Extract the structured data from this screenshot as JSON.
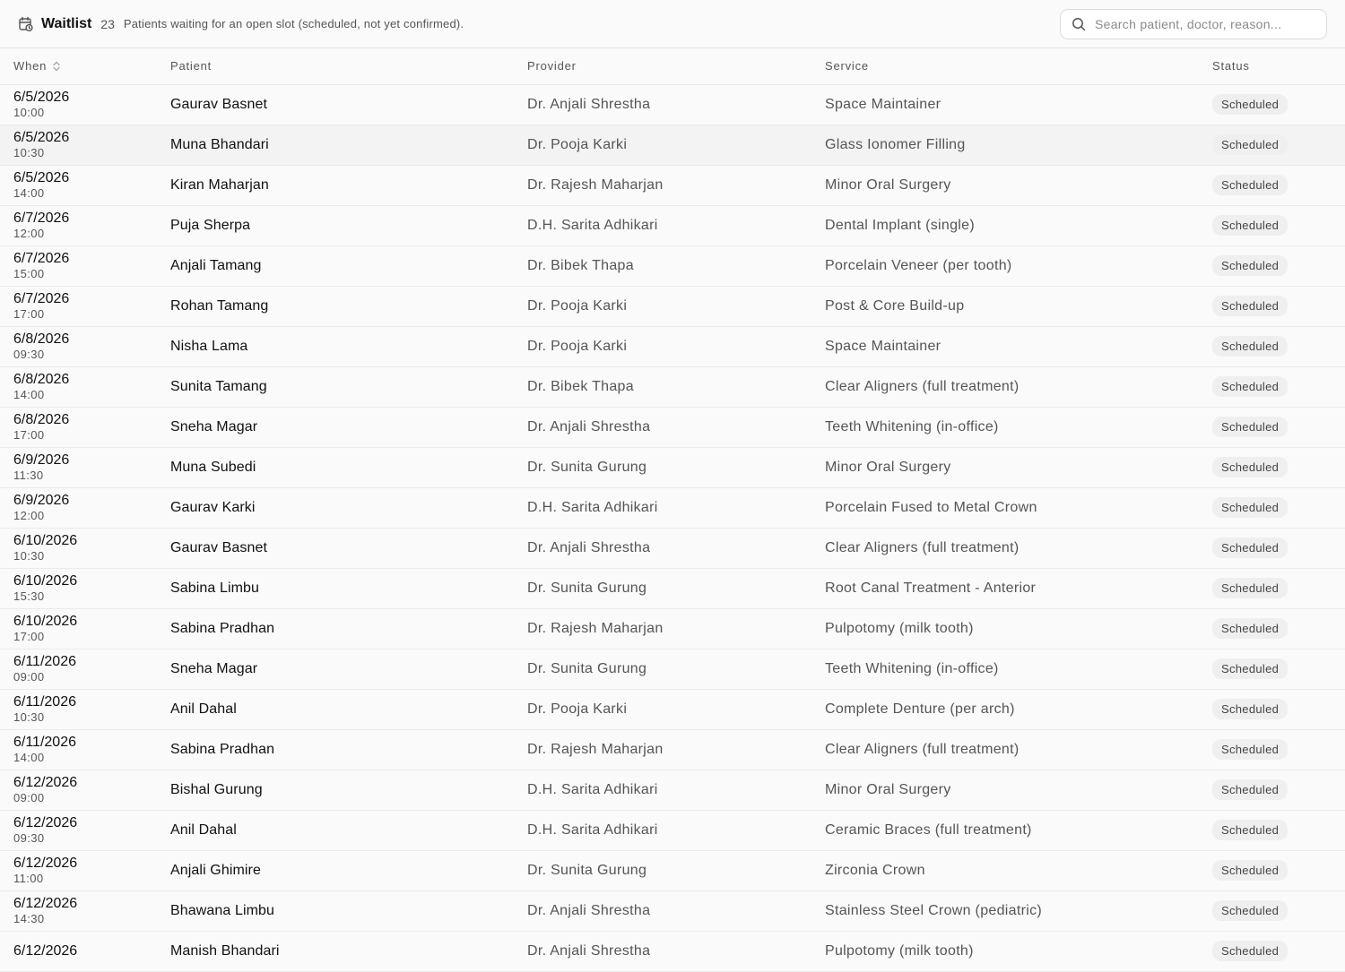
{
  "header": {
    "title": "Waitlist",
    "count": "23",
    "description": "Patients waiting for an open slot (scheduled, not yet confirmed).",
    "icon": "calendar-clock-icon"
  },
  "search": {
    "placeholder": "Search patient, doctor, reason...",
    "value": ""
  },
  "table": {
    "columns": [
      "When",
      "Patient",
      "Provider",
      "Service",
      "Status"
    ],
    "rows": [
      {
        "date": "6/5/2026",
        "time": "10:00",
        "patient": "Gaurav Basnet",
        "provider": "Dr. Anjali Shrestha",
        "service": "Space Maintainer",
        "status": "Scheduled"
      },
      {
        "date": "6/5/2026",
        "time": "10:30",
        "patient": "Muna Bhandari",
        "provider": "Dr. Pooja Karki",
        "service": "Glass Ionomer Filling",
        "status": "Scheduled"
      },
      {
        "date": "6/5/2026",
        "time": "14:00",
        "patient": "Kiran Maharjan",
        "provider": "Dr. Rajesh Maharjan",
        "service": "Minor Oral Surgery",
        "status": "Scheduled"
      },
      {
        "date": "6/7/2026",
        "time": "12:00",
        "patient": "Puja Sherpa",
        "provider": "D.H. Sarita Adhikari",
        "service": "Dental Implant (single)",
        "status": "Scheduled"
      },
      {
        "date": "6/7/2026",
        "time": "15:00",
        "patient": "Anjali Tamang",
        "provider": "Dr. Bibek Thapa",
        "service": "Porcelain Veneer (per tooth)",
        "status": "Scheduled"
      },
      {
        "date": "6/7/2026",
        "time": "17:00",
        "patient": "Rohan Tamang",
        "provider": "Dr. Pooja Karki",
        "service": "Post & Core Build-up",
        "status": "Scheduled"
      },
      {
        "date": "6/8/2026",
        "time": "09:30",
        "patient": "Nisha Lama",
        "provider": "Dr. Pooja Karki",
        "service": "Space Maintainer",
        "status": "Scheduled"
      },
      {
        "date": "6/8/2026",
        "time": "14:00",
        "patient": "Sunita Tamang",
        "provider": "Dr. Bibek Thapa",
        "service": "Clear Aligners (full treatment)",
        "status": "Scheduled"
      },
      {
        "date": "6/8/2026",
        "time": "17:00",
        "patient": "Sneha Magar",
        "provider": "Dr. Anjali Shrestha",
        "service": "Teeth Whitening (in-office)",
        "status": "Scheduled"
      },
      {
        "date": "6/9/2026",
        "time": "11:30",
        "patient": "Muna Subedi",
        "provider": "Dr. Sunita Gurung",
        "service": "Minor Oral Surgery",
        "status": "Scheduled"
      },
      {
        "date": "6/9/2026",
        "time": "12:00",
        "patient": "Gaurav Karki",
        "provider": "D.H. Sarita Adhikari",
        "service": "Porcelain Fused to Metal Crown",
        "status": "Scheduled"
      },
      {
        "date": "6/10/2026",
        "time": "10:30",
        "patient": "Gaurav Basnet",
        "provider": "Dr. Anjali Shrestha",
        "service": "Clear Aligners (full treatment)",
        "status": "Scheduled"
      },
      {
        "date": "6/10/2026",
        "time": "15:30",
        "patient": "Sabina Limbu",
        "provider": "Dr. Sunita Gurung",
        "service": "Root Canal Treatment - Anterior",
        "status": "Scheduled"
      },
      {
        "date": "6/10/2026",
        "time": "17:00",
        "patient": "Sabina Pradhan",
        "provider": "Dr. Rajesh Maharjan",
        "service": "Pulpotomy (milk tooth)",
        "status": "Scheduled"
      },
      {
        "date": "6/11/2026",
        "time": "09:00",
        "patient": "Sneha Magar",
        "provider": "Dr. Sunita Gurung",
        "service": "Teeth Whitening (in-office)",
        "status": "Scheduled"
      },
      {
        "date": "6/11/2026",
        "time": "10:30",
        "patient": "Anil Dahal",
        "provider": "Dr. Pooja Karki",
        "service": "Complete Denture (per arch)",
        "status": "Scheduled"
      },
      {
        "date": "6/11/2026",
        "time": "14:00",
        "patient": "Sabina Pradhan",
        "provider": "Dr. Rajesh Maharjan",
        "service": "Clear Aligners (full treatment)",
        "status": "Scheduled"
      },
      {
        "date": "6/12/2026",
        "time": "09:00",
        "patient": "Bishal Gurung",
        "provider": "D.H. Sarita Adhikari",
        "service": "Minor Oral Surgery",
        "status": "Scheduled"
      },
      {
        "date": "6/12/2026",
        "time": "09:30",
        "patient": "Anil Dahal",
        "provider": "D.H. Sarita Adhikari",
        "service": "Ceramic Braces (full treatment)",
        "status": "Scheduled"
      },
      {
        "date": "6/12/2026",
        "time": "11:00",
        "patient": "Anjali Ghimire",
        "provider": "Dr. Sunita Gurung",
        "service": "Zirconia Crown",
        "status": "Scheduled"
      },
      {
        "date": "6/12/2026",
        "time": "14:30",
        "patient": "Bhawana Limbu",
        "provider": "Dr. Anjali Shrestha",
        "service": "Stainless Steel Crown (pediatric)",
        "status": "Scheduled"
      },
      {
        "date": "6/12/2026",
        "time": "",
        "patient": "Manish Bhandari",
        "provider": "Dr. Anjali Shrestha",
        "service": "Pulpotomy (milk tooth)",
        "status": "Scheduled"
      }
    ]
  }
}
